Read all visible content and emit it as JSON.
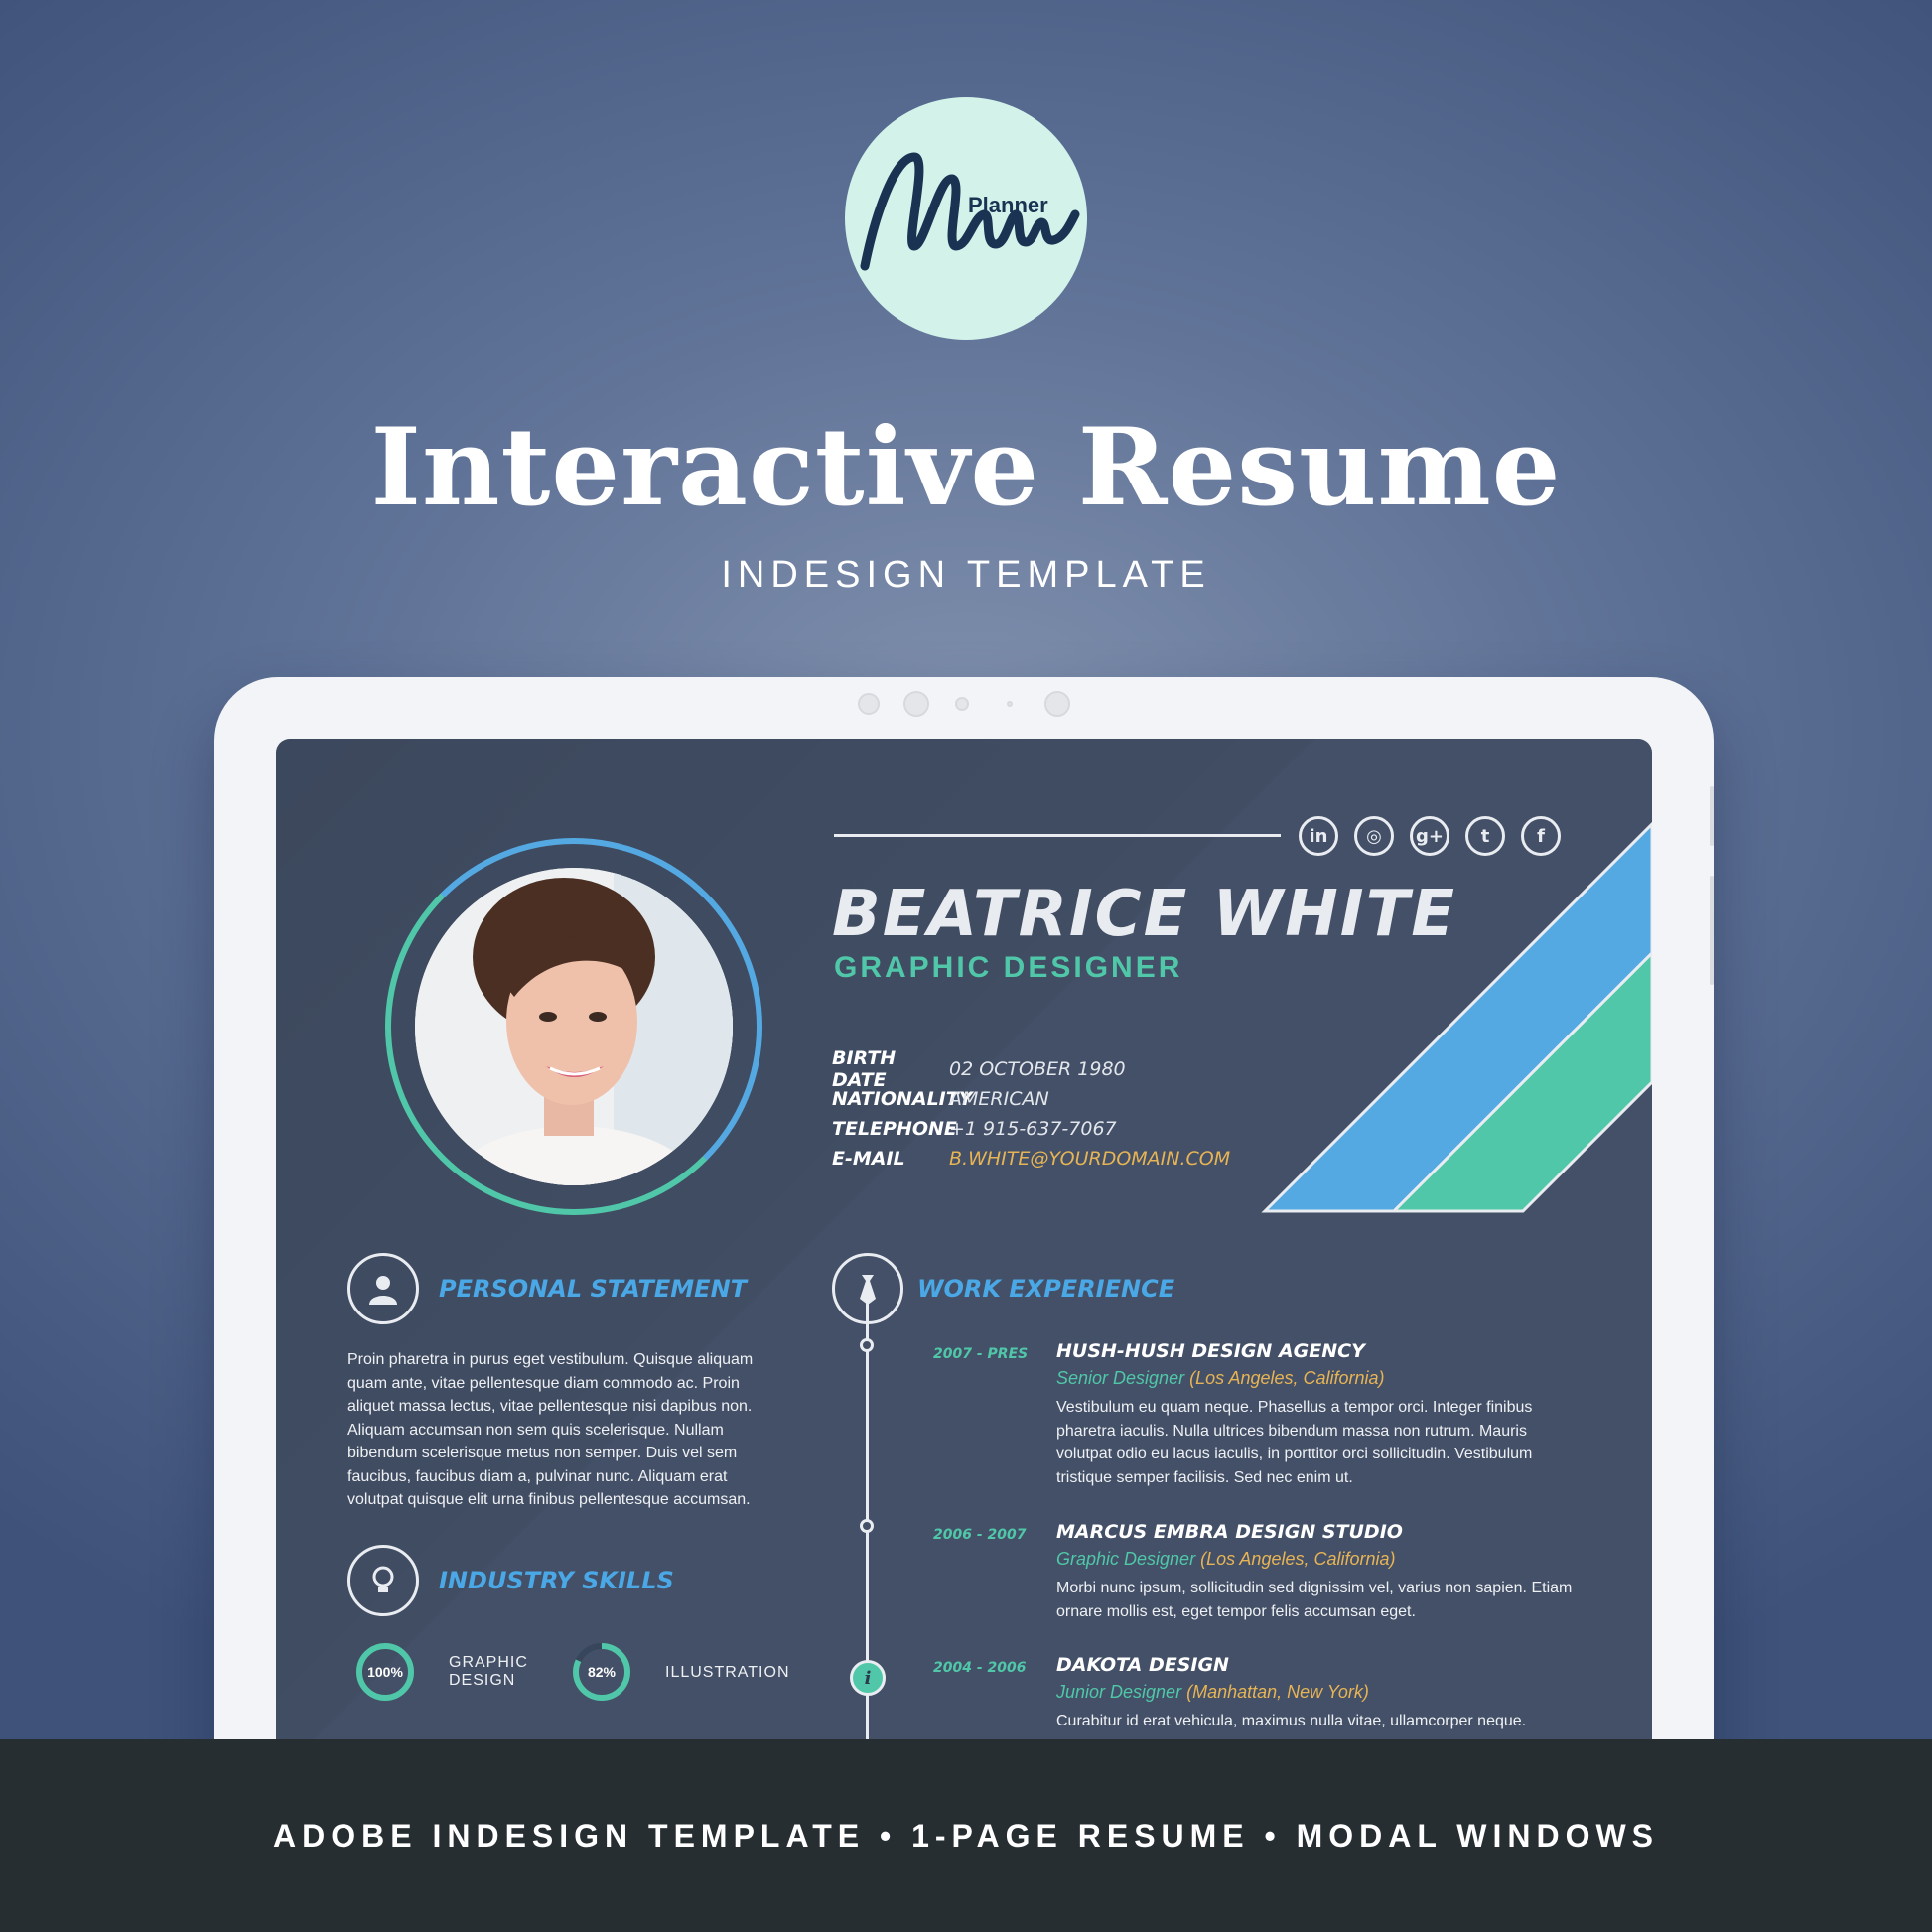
{
  "logo": {
    "planner": "Planner",
    "script_text": "Mum",
    "bg_color": "#d2f2ea",
    "ink_color": "#1b3352"
  },
  "header": {
    "title": "Interactive Resume",
    "subtitle": "INDESIGN TEMPLATE"
  },
  "resume": {
    "name": "BEATRICE  WHITE",
    "role": "GRAPHIC DESIGNER",
    "social_icons": [
      "linkedin-icon",
      "dribbble-icon",
      "google-plus-icon",
      "twitter-icon",
      "facebook-icon"
    ],
    "social_glyphs": [
      "in",
      "◎",
      "g+",
      "t",
      "f"
    ],
    "details": [
      {
        "key": "BIRTH DATE",
        "value": "02 OCTOBER 1980"
      },
      {
        "key": "NATIONALITY",
        "value": "AMERICAN"
      },
      {
        "key": "TELEPHONE",
        "value": "+1 915-637-7067"
      },
      {
        "key": "E-MAIL",
        "value": "B.WHITE@YOURDOMAIN.COM"
      }
    ],
    "personal_statement": {
      "title": "PERSONAL STATEMENT",
      "text": "Proin pharetra in purus eget vestibulum. Quisque aliquam quam ante, vitae pellentesque diam commodo ac. Proin aliquet massa lectus, vitae pellentesque nisi dapibus non. Aliquam accumsan non sem quis scelerisque. Nullam bibendum scelerisque metus non semper. Duis vel sem faucibus, faucibus diam a, pulvinar nunc. Aliquam erat volutpat quisque elit urna finibus pellentesque accumsan."
    },
    "industry_skills": {
      "title": "INDUSTRY SKILLS",
      "items": [
        {
          "pct_label": "100%",
          "value": 100,
          "label_line1": "GRAPHIC",
          "label_line2": "DESIGN"
        },
        {
          "pct_label": "82%",
          "value": 82,
          "label_line1": "ILLUSTRATION",
          "label_line2": ""
        }
      ]
    },
    "work_experience": {
      "title": "WORK EXPERIENCE",
      "jobs": [
        {
          "dates": "2007 - PRES",
          "company": "HUSH-HUSH DESIGN AGENCY",
          "position": "Senior Designer",
          "location": "(Los Angeles, California)",
          "description": "Vestibulum eu quam neque. Phasellus a tempor orci. Integer finibus pharetra iaculis. Nulla ultrices bibendum massa non rutrum. Mauris volutpat odio eu lacus iaculis, in porttitor orci sollicitudin. Vestibulum tristique semper facilisis. Sed nec enim ut."
        },
        {
          "dates": "2006 - 2007",
          "company": "MARCUS EMBRA DESIGN STUDIO",
          "position": "Graphic Designer",
          "location": "(Los Angeles, California)",
          "description": "Morbi nunc ipsum, sollicitudin sed dignissim vel, varius non sapien. Etiam ornare mollis est, eget tempor felis accumsan eget."
        },
        {
          "dates": "2004 - 2006",
          "company": "DAKOTA DESIGN",
          "position": "Junior Designer",
          "location": "(Manhattan, New York)",
          "description": "Curabitur id erat vehicula, maximus nulla vitae, ullamcorper neque."
        }
      ]
    },
    "colors": {
      "accent_blue": "#55a9e2",
      "accent_green": "#50c7a8",
      "accent_gold": "#e7b455",
      "screen_bg": "#435067"
    }
  },
  "footer": {
    "text": "ADOBE INDESIGN TEMPLATE • 1-PAGE RESUME • MODAL WINDOWS"
  }
}
